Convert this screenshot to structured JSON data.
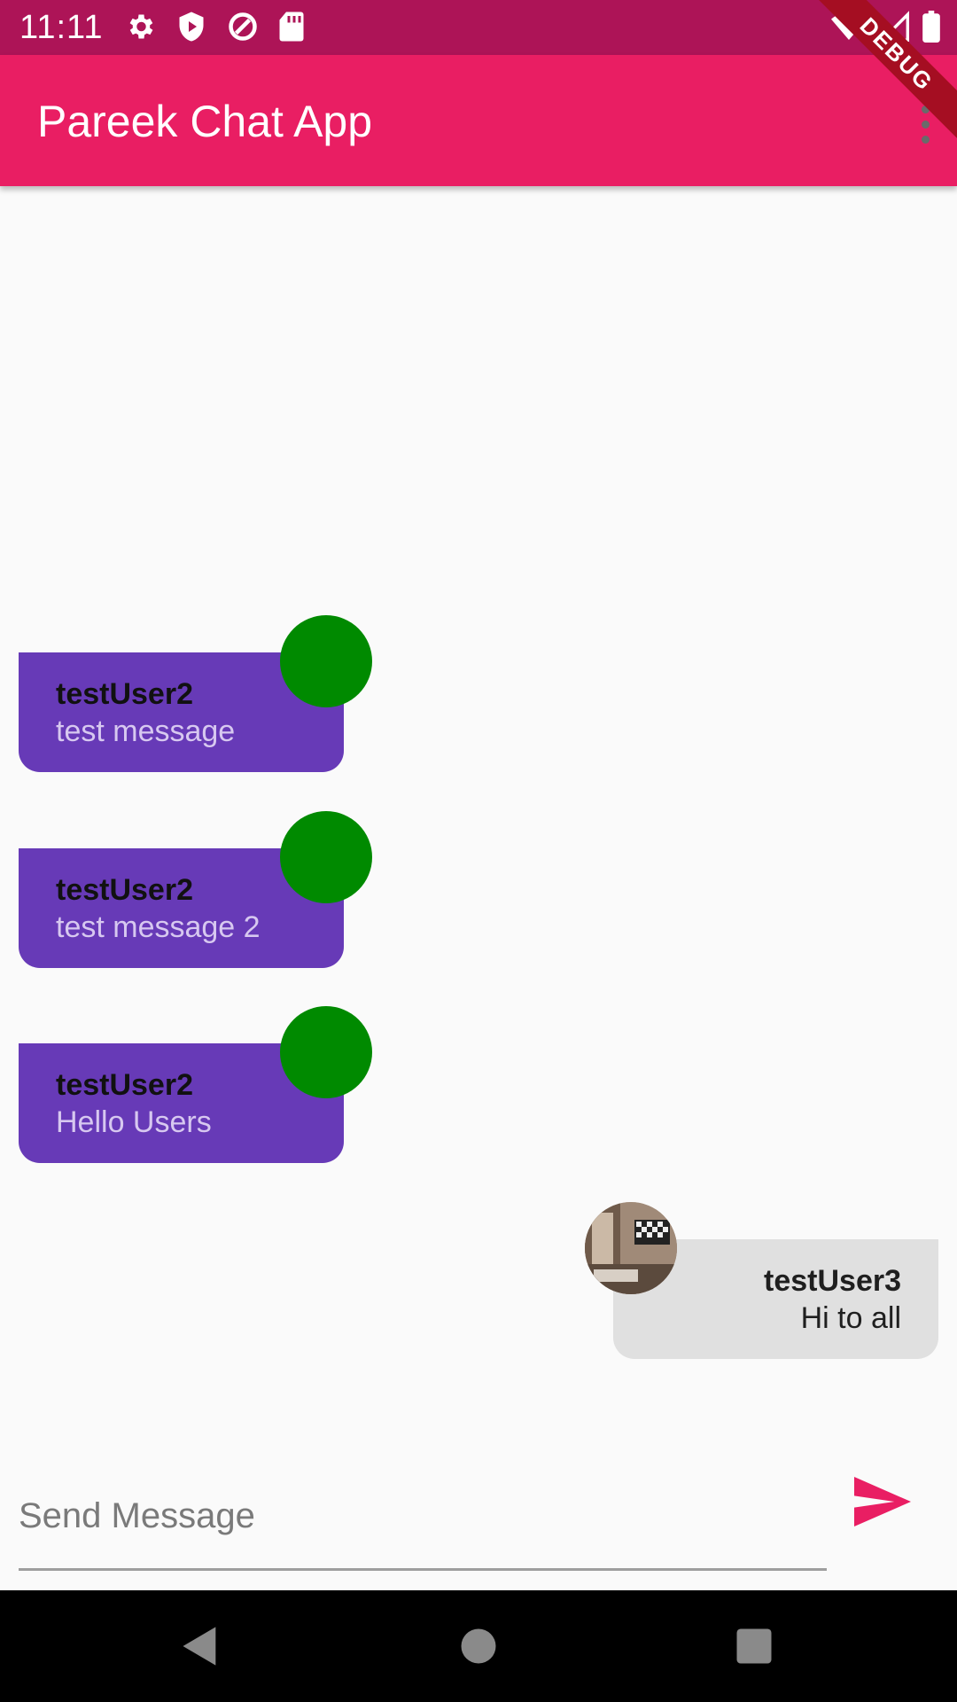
{
  "status_bar": {
    "time": "11:11",
    "left_icons": [
      "gear-icon",
      "shield-play-icon",
      "data-saver-icon",
      "sd-card-icon"
    ],
    "right_icons": [
      "wifi-icon",
      "signal-icon",
      "battery-icon"
    ]
  },
  "debug_banner": "DEBUG",
  "app_bar": {
    "title": "Pareek Chat App",
    "menu_icon": "more-vert-icon",
    "color": "#e91e63"
  },
  "messages": [
    {
      "sender": "testUser2",
      "text": "test message",
      "side": "left",
      "avatar": "green-circle",
      "bubble_color": "#673ab7",
      "avatar_color": "#008a00"
    },
    {
      "sender": "testUser2",
      "text": "test message 2",
      "side": "left",
      "avatar": "green-circle",
      "bubble_color": "#673ab7",
      "avatar_color": "#008a00"
    },
    {
      "sender": "testUser2",
      "text": "Hello Users",
      "side": "left",
      "avatar": "green-circle",
      "bubble_color": "#673ab7",
      "avatar_color": "#008a00"
    },
    {
      "sender": "testUser3",
      "text": "Hi to all",
      "side": "right",
      "avatar": "photo",
      "bubble_color": "#e0e0e0"
    }
  ],
  "composer": {
    "placeholder": "Send Message",
    "value": "",
    "send_icon": "send-icon",
    "send_color": "#e91e63"
  },
  "nav_bar": {
    "icons": [
      "back-icon",
      "home-icon",
      "recents-icon"
    ]
  }
}
